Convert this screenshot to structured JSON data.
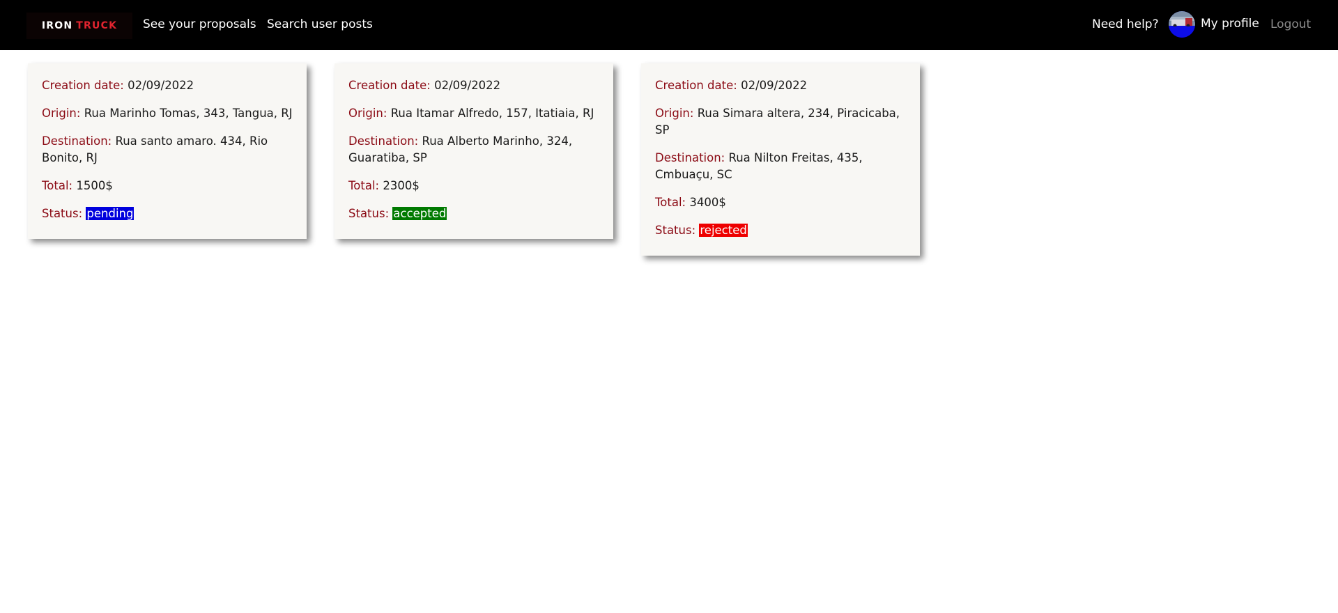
{
  "nav": {
    "brand": {
      "word1": "IRON",
      "word2": "TRUCK"
    },
    "links": {
      "proposals": "See your proposals",
      "search": "Search user posts",
      "help": "Need help?",
      "profile": "My profile",
      "logout": "Logout"
    },
    "avatar_icon": "profile-avatar"
  },
  "labels": {
    "creation_date": "Creation date:",
    "origin": "Origin:",
    "destination": "Destination:",
    "total": "Total:",
    "status": "Status:"
  },
  "colors": {
    "label": "#8b0a14",
    "brand_accent": "#e0242f",
    "pending": "#0000dd",
    "accepted": "#007a00",
    "rejected": "#ee0000"
  },
  "proposals": [
    {
      "creation_date": "02/09/2022",
      "origin": "Rua Marinho Tomas, 343, Tangua, RJ",
      "destination": "Rua santo amaro. 434, Rio Bonito, RJ",
      "total": "1500$",
      "status": "pending"
    },
    {
      "creation_date": "02/09/2022",
      "origin": "Rua Itamar Alfredo, 157, Itatiaia, RJ",
      "destination": "Rua Alberto Marinho, 324, Guaratiba, SP",
      "total": "2300$",
      "status": "accepted"
    },
    {
      "creation_date": "02/09/2022",
      "origin": "Rua Simara altera, 234, Piracicaba, SP",
      "destination": "Rua Nilton Freitas, 435, Cmbuaçu, SC",
      "total": "3400$",
      "status": "rejected"
    }
  ]
}
